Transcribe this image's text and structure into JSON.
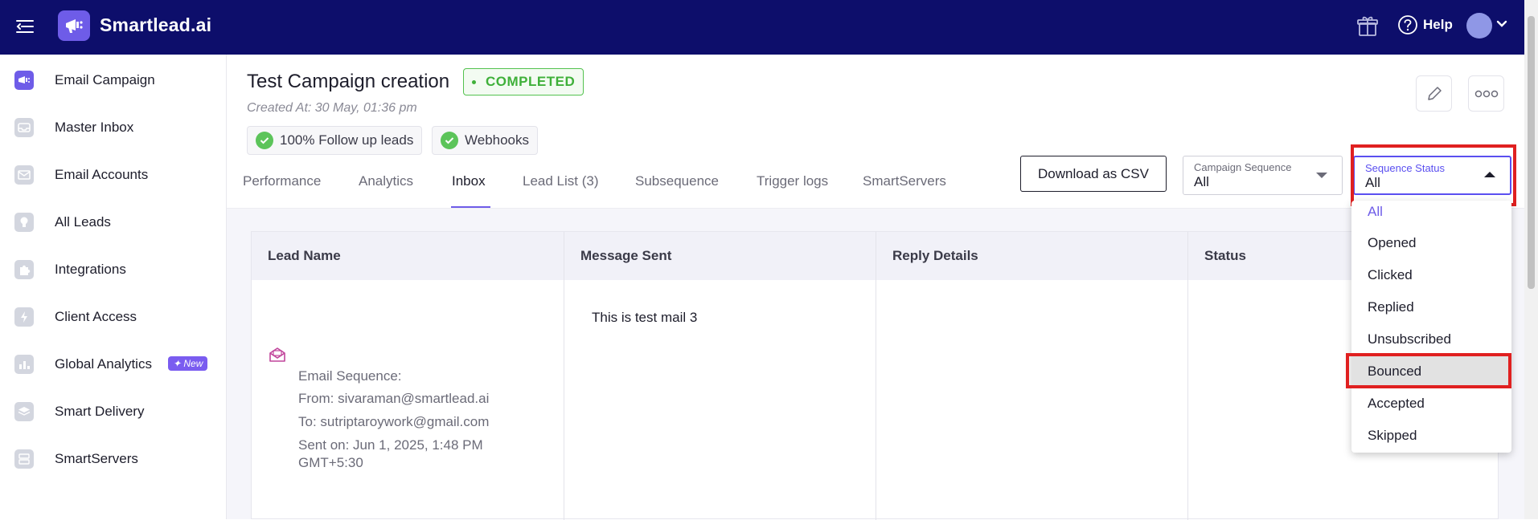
{
  "topbar": {
    "brand": "Smartlead.ai",
    "help_label": "Help",
    "bg_color": "#0d0e6b",
    "icons": [
      "menu-toggle-icon",
      "logo-icon",
      "gift-icon",
      "help-icon",
      "avatar",
      "chevron-down-icon"
    ]
  },
  "sidebar": {
    "items": [
      {
        "label": "Email Campaign",
        "icon": "megaphone-icon",
        "active": true
      },
      {
        "label": "Master Inbox",
        "icon": "inbox-icon"
      },
      {
        "label": "Email Accounts",
        "icon": "mail-icon"
      },
      {
        "label": "All Leads",
        "icon": "lightbulb-icon"
      },
      {
        "label": "Integrations",
        "icon": "puzzle-icon"
      },
      {
        "label": "Client Access",
        "icon": "bolt-icon"
      },
      {
        "label": "Global Analytics",
        "icon": "bar-chart-icon",
        "badge": "✦ New"
      },
      {
        "label": "Smart Delivery",
        "icon": "layers-icon"
      },
      {
        "label": "SmartServers",
        "icon": "server-icon"
      }
    ]
  },
  "campaign": {
    "title": "Test Campaign creation",
    "status": "COMPLETED",
    "created": "Created At: 30 May, 01:36 pm",
    "chips": [
      "100% Follow up leads",
      "Webhooks"
    ]
  },
  "tabs": [
    {
      "label": "Performance"
    },
    {
      "label": "Analytics"
    },
    {
      "label": "Inbox",
      "active": true
    },
    {
      "label": "Lead List (3)"
    },
    {
      "label": "Subsequence"
    },
    {
      "label": "Trigger logs"
    },
    {
      "label": "SmartServers"
    }
  ],
  "toolbar": {
    "csv_label": "Download as CSV",
    "campaign_sequence": {
      "label": "Campaign Sequence",
      "value": "All"
    },
    "sequence_status": {
      "label": "Sequence Status",
      "value": "All"
    }
  },
  "table": {
    "headers": [
      "Lead Name",
      "Message Sent",
      "Reply Details",
      "Status"
    ],
    "row": {
      "sequence_label": "Email Sequence:",
      "from": "From: sivaraman@smartlead.ai",
      "to": "To: sutriptaroywork@gmail.com",
      "sent_on_1": "Sent on: Jun 1, 2025, 1:48 PM",
      "sent_on_2": "GMT+5:30",
      "message": "This is test mail 3"
    }
  },
  "dropdown": {
    "options": [
      "All",
      "Opened",
      "Clicked",
      "Replied",
      "Unsubscribed",
      "Bounced",
      "Accepted",
      "Skipped"
    ],
    "selected": "All",
    "highlighted": "Bounced"
  },
  "colors": {
    "accent": "#6e5ce8",
    "success": "#3fb03a",
    "highlight_box": "#e02020"
  }
}
